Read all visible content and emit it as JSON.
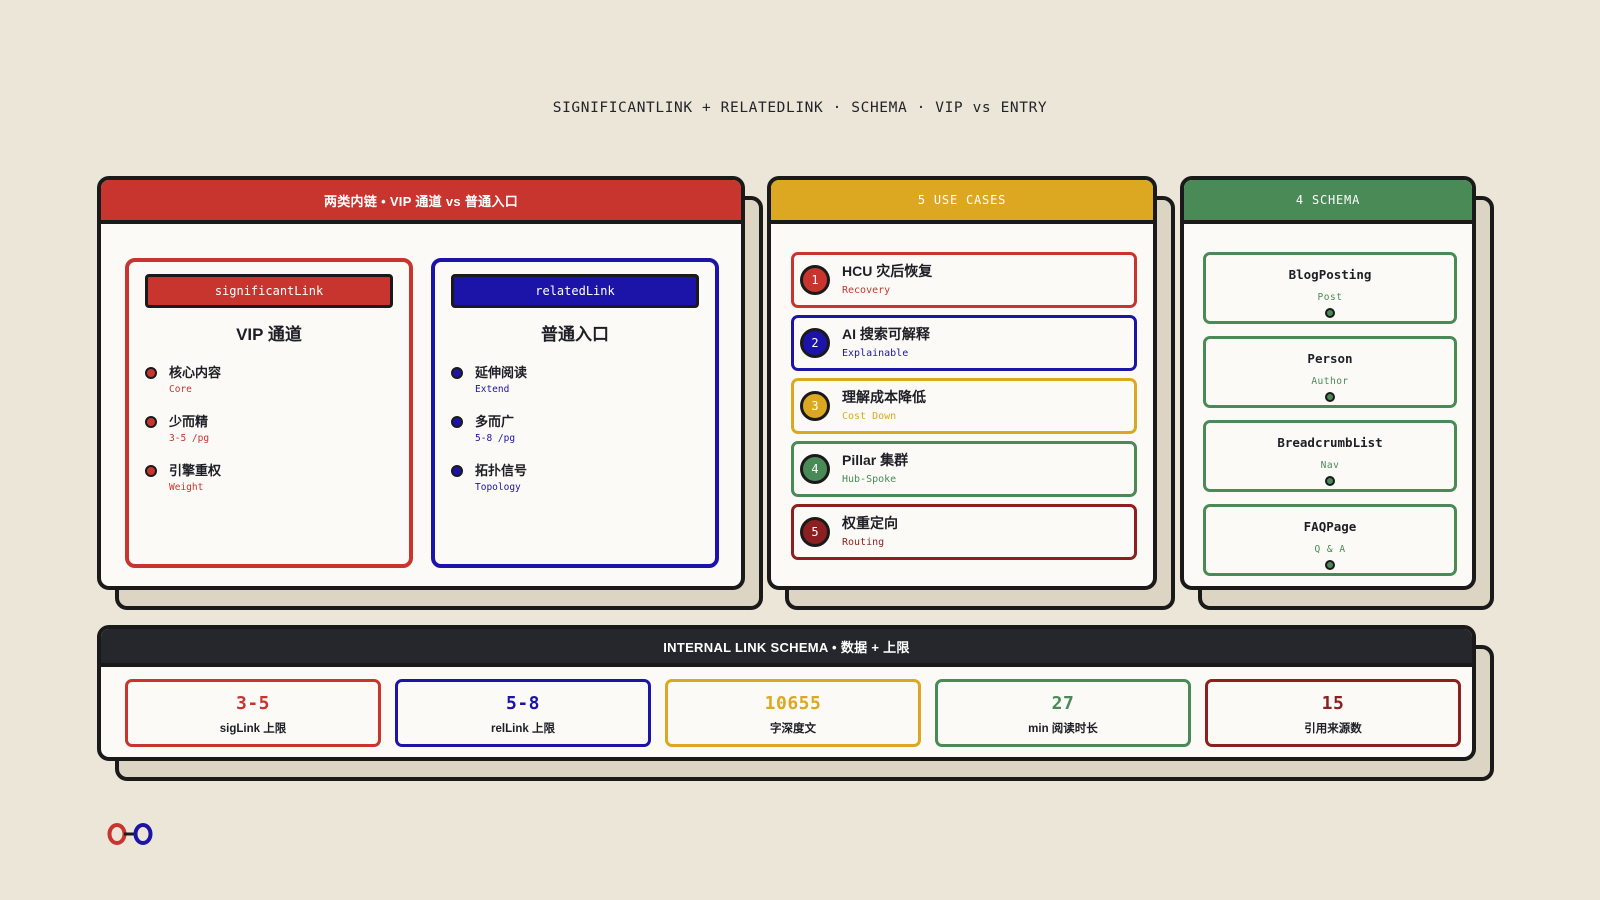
{
  "page_title": "SIGNIFICANTLINK + RELATEDLINK · SCHEMA · VIP vs ENTRY",
  "colors": {
    "red": "#c8352f",
    "blue": "#1c14a8",
    "yellow": "#dca822",
    "green": "#4a8a57",
    "maroon": "#8c1f1f",
    "dark": "#26272d",
    "background": "#ebe6d8"
  },
  "left_panel": {
    "header": "两类内链 • VIP 通道 vs 普通入口",
    "significant": {
      "tag": "significantLink",
      "title": "VIP 通道",
      "items": [
        {
          "title": "核心内容",
          "sub": "Core"
        },
        {
          "title": "少而精",
          "sub": "3-5 /pg"
        },
        {
          "title": "引擎重权",
          "sub": "Weight"
        }
      ]
    },
    "related": {
      "tag": "relatedLink",
      "title": "普通入口",
      "items": [
        {
          "title": "延伸阅读",
          "sub": "Extend"
        },
        {
          "title": "多而广",
          "sub": "5-8 /pg"
        },
        {
          "title": "拓扑信号",
          "sub": "Topology"
        }
      ]
    }
  },
  "use_cases": {
    "header": "5 USE CASES",
    "items": [
      {
        "num": "1",
        "title": "HCU 灾后恢复",
        "sub": "Recovery",
        "color": "#c8352f"
      },
      {
        "num": "2",
        "title": "AI 搜索可解释",
        "sub": "Explainable",
        "color": "#1c14a8"
      },
      {
        "num": "3",
        "title": "理解成本降低",
        "sub": "Cost Down",
        "color": "#dca822"
      },
      {
        "num": "4",
        "title": "Pillar 集群",
        "sub": "Hub-Spoke",
        "color": "#4a8a57"
      },
      {
        "num": "5",
        "title": "权重定向",
        "sub": "Routing",
        "color": "#8c1f1f"
      }
    ]
  },
  "schema": {
    "header": "4 SCHEMA",
    "items": [
      {
        "title": "BlogPosting",
        "sub": "Post"
      },
      {
        "title": "Person",
        "sub": "Author"
      },
      {
        "title": "BreadcrumbList",
        "sub": "Nav"
      },
      {
        "title": "FAQPage",
        "sub": "Q & A"
      }
    ]
  },
  "stats": {
    "header": "INTERNAL LINK SCHEMA • 数据 + 上限",
    "items": [
      {
        "value": "3-5",
        "label": "sigLink 上限",
        "color": "#c8352f"
      },
      {
        "value": "5-8",
        "label": "relLink 上限",
        "color": "#1c14a8"
      },
      {
        "value": "10655",
        "label": "字深度文",
        "color": "#dca822"
      },
      {
        "value": "27",
        "label": "min 阅读时长",
        "color": "#4a8a57"
      },
      {
        "value": "15",
        "label": "引用来源数",
        "color": "#8c1f1f"
      }
    ]
  }
}
